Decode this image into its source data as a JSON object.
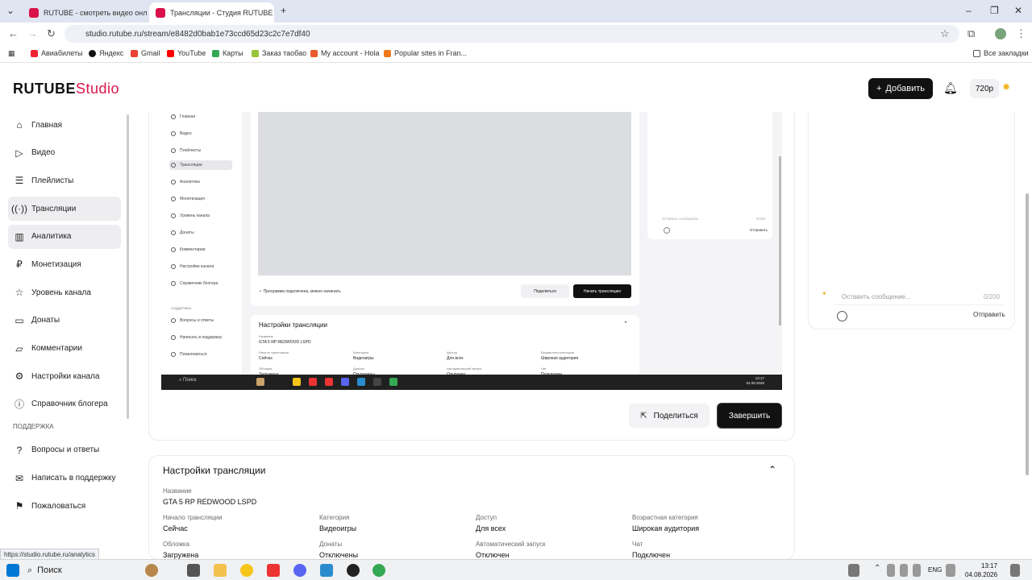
{
  "browser": {
    "tabs": [
      {
        "title": "RUTUBE - смотреть видео онл"
      },
      {
        "title": "Трансляции - Студия RUTUBE"
      }
    ],
    "url": "studio.rutube.ru/stream/e8482d0bab1e73ccd65d23c2c7e7df40",
    "bookmarks": [
      "Авиабилеты",
      "Яндекс",
      "Gmail",
      "YouTube",
      "Карты",
      "Заказ таобао",
      "My account - Hola",
      "Popular sites in Fran..."
    ],
    "all_bookmarks": "Все закладки",
    "status_url": "https://studio.rutube.ru/analytics"
  },
  "header": {
    "logo_main": "RUTUBE",
    "logo_studio": "Studio",
    "add_label": "Добавить",
    "quality": "720р"
  },
  "sidebar": {
    "items": [
      {
        "label": "Главная"
      },
      {
        "label": "Видео"
      },
      {
        "label": "Плейлисты"
      },
      {
        "label": "Трансляции"
      },
      {
        "label": "Аналитика"
      },
      {
        "label": "Монетизация"
      },
      {
        "label": "Уровень канала"
      },
      {
        "label": "Донаты"
      },
      {
        "label": "Комментарии"
      },
      {
        "label": "Настройки канала"
      },
      {
        "label": "Справочник блогера"
      }
    ],
    "support_title": "ПОДДЕРЖКА",
    "support_items": [
      {
        "label": "Вопросы и ответы"
      },
      {
        "label": "Написать в поддержку"
      },
      {
        "label": "Пожаловаться"
      }
    ]
  },
  "preview": {
    "side_items": [
      "Главная",
      "Видео",
      "Плейлисты",
      "Трансляции",
      "Аналитика",
      "Монетизация",
      "Уровень канала",
      "Донаты",
      "Комментарии",
      "Настройки канала",
      "Справочник блогера"
    ],
    "support_title": "ПОДДЕРЖКА",
    "support_items": [
      "Вопросы и ответы",
      "Написать в поддержку",
      "Пожаловаться"
    ],
    "ok_text": "Программа подключена, можно начинать",
    "share": "Поделиться",
    "start": "Начать трансляцию",
    "settings_title": "Настройки трансляции",
    "name_label": "Название",
    "name_value": "GTA 5 RP REDWOOD LSPD",
    "fields": [
      {
        "label": "Начало трансляции",
        "value": "Сейчас"
      },
      {
        "label": "Категория",
        "value": "Видеоигры"
      },
      {
        "label": "Доступ",
        "value": "Для всех"
      },
      {
        "label": "Возрастная категория",
        "value": "Широкая аудитория"
      },
      {
        "label": "Обложка",
        "value": "Загружена"
      },
      {
        "label": "Донаты",
        "value": "Отключены"
      },
      {
        "label": "Автоматический запуск",
        "value": "Отключен"
      },
      {
        "label": "Чат",
        "value": "Подключен"
      }
    ],
    "chat_placeholder": "Оставить сообщение...",
    "chat_count": "0/200",
    "chat_send": "Отправить",
    "taskbar_search": "Поиск",
    "time": "13:17",
    "date": "04.08.2026"
  },
  "actions": {
    "share": "Поделиться",
    "finish": "Завершить"
  },
  "chat": {
    "placeholder": "Оставить сообщение...",
    "count": "0/200",
    "send": "Отправить"
  },
  "settings": {
    "title": "Настройки трансляции",
    "name_label": "Название",
    "name_value": "GTA 5 RP REDWOOD LSPD",
    "fields": [
      {
        "label": "Начало трансляции",
        "value": "Сейчас"
      },
      {
        "label": "Категория",
        "value": "Видеоигры"
      },
      {
        "label": "Доступ",
        "value": "Для всех"
      },
      {
        "label": "Возрастная категория",
        "value": "Широкая аудитория"
      },
      {
        "label": "Обложка",
        "value": "Загружена"
      },
      {
        "label": "Донаты",
        "value": "Отключены"
      },
      {
        "label": "Автоматический запуск",
        "value": "Отключен"
      },
      {
        "label": "Чат",
        "value": "Подключен"
      }
    ]
  },
  "taskbar": {
    "search": "Поиск",
    "lang": "ENG",
    "time": "13:17",
    "date": "04.08.2026"
  },
  "colors": {
    "brand": "#d9134a",
    "primary_button": "#111111",
    "active_bg": "#eeeef1"
  }
}
